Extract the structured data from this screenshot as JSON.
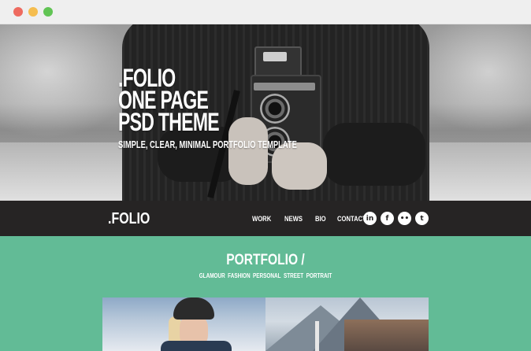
{
  "window": {
    "controls": [
      "close",
      "minimize",
      "zoom"
    ],
    "colors": {
      "close": "#ee6a5f",
      "minimize": "#f5bd4f",
      "zoom": "#61c454"
    }
  },
  "hero": {
    "title_lines": [
      ".FOLIO",
      "ONE PAGE",
      "PSD THEME"
    ],
    "subtitle": "SIMPLE, CLEAR, MINIMAL PORTFOLIO TEMPLATE"
  },
  "nav": {
    "logo": ".FOLIO",
    "links": [
      "WORK",
      "NEWS",
      "BIO",
      "CONTACT"
    ],
    "socials": [
      {
        "icon": "linkedin-icon",
        "glyph": "in"
      },
      {
        "icon": "facebook-icon",
        "glyph": "f"
      },
      {
        "icon": "flickr-icon",
        "glyph": "••"
      },
      {
        "icon": "twitter-icon",
        "glyph": "t"
      }
    ],
    "bg_color": "#262424"
  },
  "portfolio": {
    "title": "PORTFOLIO /",
    "filters": [
      "GLAMOUR",
      "FASHION",
      "PERSONAL",
      "STREET",
      "PORTRAIT"
    ],
    "bg_color": "#62bb96"
  }
}
